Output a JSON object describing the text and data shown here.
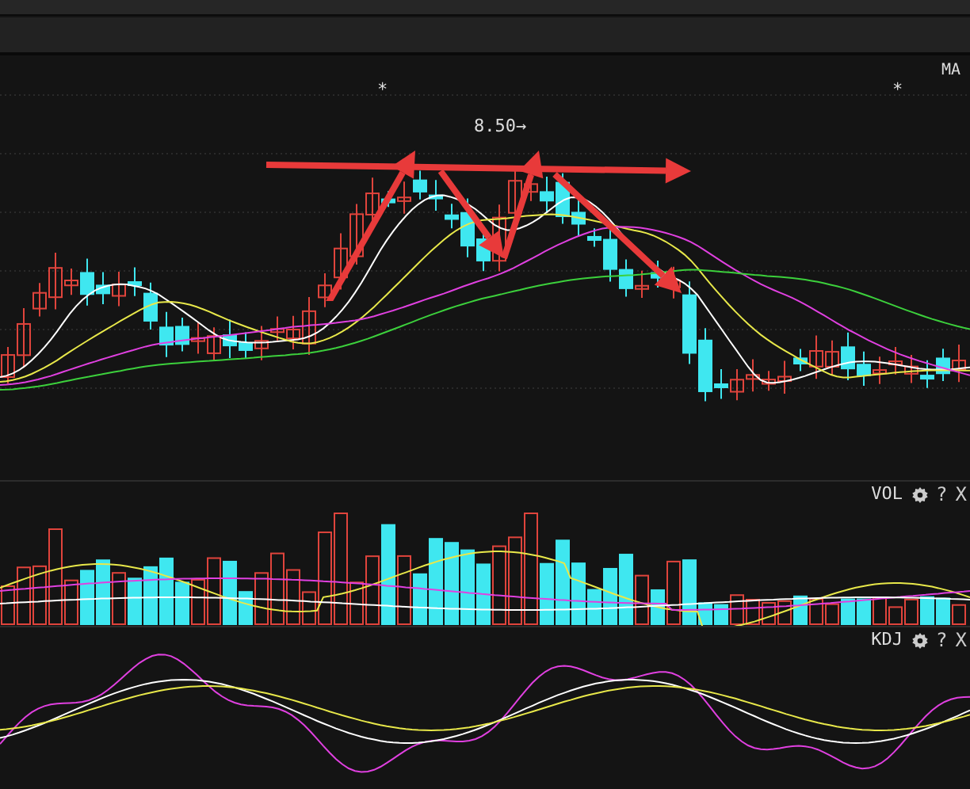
{
  "main_panel": {
    "indicator_label": "MA",
    "markers": [
      "*",
      "*"
    ],
    "price_label": "8.50→"
  },
  "panels": [
    {
      "label": "VOL",
      "help": "?",
      "close": "X"
    },
    {
      "label": "KDJ",
      "help": "?",
      "close": "X"
    }
  ]
}
